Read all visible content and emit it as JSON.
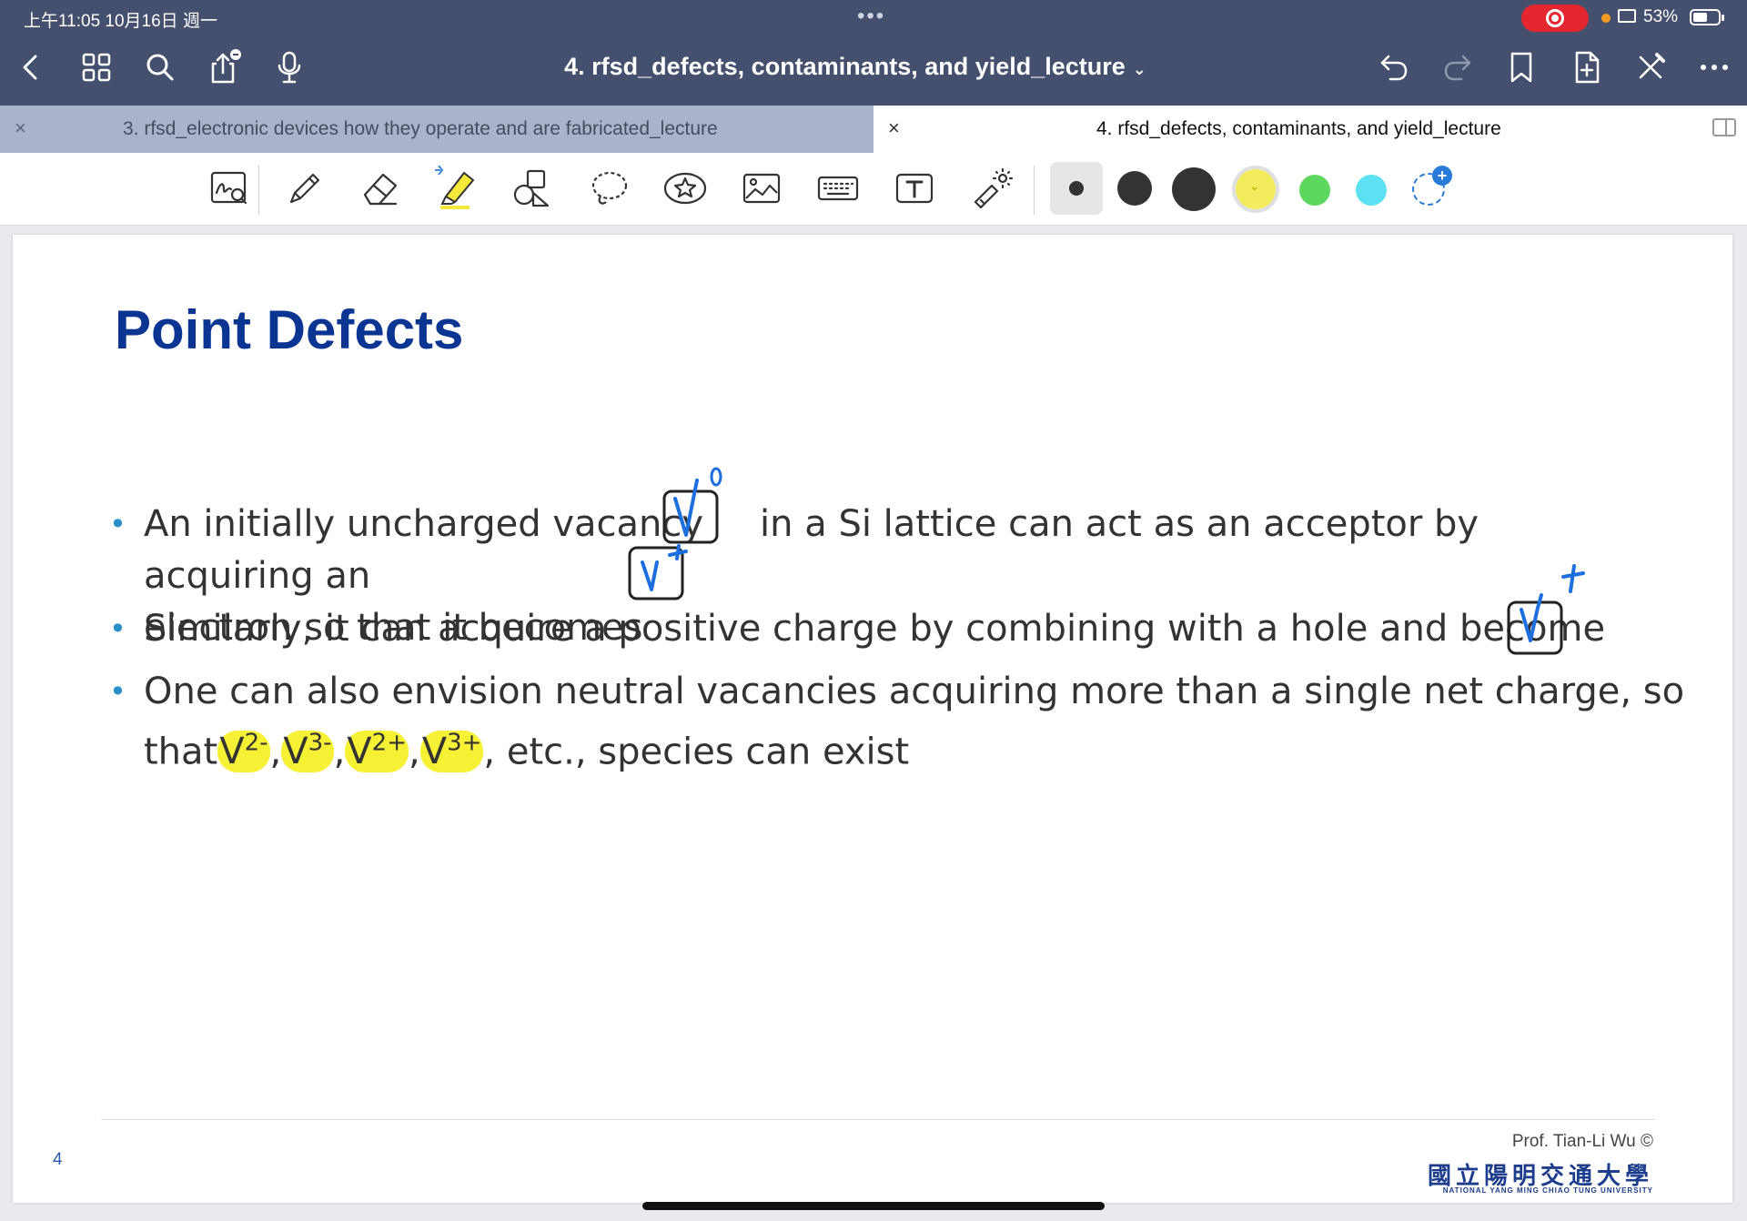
{
  "status": {
    "time": "上午11:05   10月16日 週一",
    "dots": "•••",
    "battery": "53%",
    "battery_level": 0.53
  },
  "nav": {
    "title": "4. rfsd_defects, contaminants, and yield_lecture",
    "title_chevron": "⌄"
  },
  "tabs": [
    {
      "label": "3. rfsd_electronic devices how they operate and are fabricated_lecture",
      "close": "×"
    },
    {
      "label": "4. rfsd_defects, contaminants, and yield_lecture",
      "close": "×"
    }
  ],
  "toolbar": {
    "tools": [
      "zoom-window",
      "pen",
      "eraser",
      "highlighter",
      "shapes",
      "lasso",
      "sticker",
      "image",
      "keyboard",
      "text",
      "laser-pointer"
    ],
    "colors": [
      "#333333",
      "#333333",
      "#333333",
      "#f2ec5e",
      "#5ed75e",
      "#5ce0f2"
    ],
    "active_color": "#f2ec5e"
  },
  "slide": {
    "title": "Point Defects",
    "bullet_dot": "•",
    "b1": {
      "pre": "An initially uncharged vacancy",
      "post": "in a Si lattice can act as an acceptor by acquiring an",
      "line2": "electron so that it becomes"
    },
    "b2": {
      "text": "Similarly, it can acquire a positive charge by combining with a hole and become"
    },
    "b3": {
      "line1": "One can also envision neutral vacancies acquiring more than a single net charge, so",
      "that": "that",
      "v": "V",
      "s1": "2-",
      "s2": "3-",
      "s3": "2+",
      "s4": "3+",
      "comma": ",",
      "tail": ", etc., species can exist"
    },
    "page_number": "4",
    "credit": "Prof. Tian-Li Wu ©",
    "university_cn": "國立陽明交通大學",
    "university_en": "NATIONAL YANG MING CHIAO TUNG UNIVERSITY"
  }
}
